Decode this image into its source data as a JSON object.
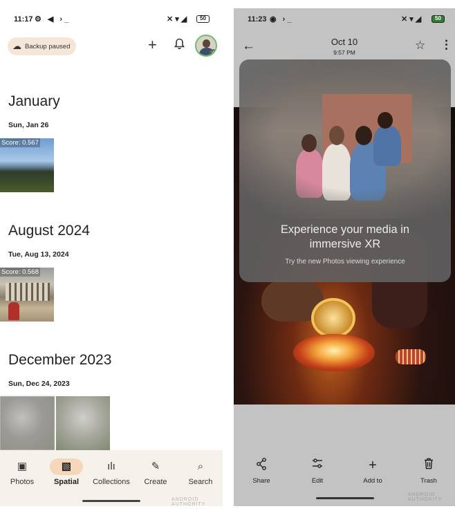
{
  "left": {
    "status": {
      "time": "11:17",
      "icons": "⚙ ◀ ›_",
      "right_icons": "🔕 ▾ ◢",
      "battery": "50"
    },
    "backup_chip": {
      "icon": "cloud-icon",
      "label": "Backup paused"
    },
    "header_icons": [
      "plus-icon",
      "bell-icon"
    ],
    "sections": [
      {
        "title": "January",
        "date": "Sun, Jan 26",
        "photos": [
          {
            "score": "Score: 0.567"
          }
        ]
      },
      {
        "title": "August 2024",
        "date": "Tue, Aug 13, 2024",
        "photos": [
          {
            "score": "Score: 0.568"
          }
        ]
      },
      {
        "title": "December 2023",
        "date": "Sun, Dec 24, 2023",
        "photos": [
          {},
          {}
        ]
      }
    ],
    "nav": [
      {
        "label": "Photos",
        "icon": "photo-icon",
        "active": false
      },
      {
        "label": "Spatial",
        "icon": "spatial-icon",
        "active": true
      },
      {
        "label": "Collections",
        "icon": "collections-icon",
        "active": false
      },
      {
        "label": "Create",
        "icon": "brush-icon",
        "active": false
      },
      {
        "label": "Search",
        "icon": "search-icon",
        "active": false
      }
    ]
  },
  "right": {
    "status": {
      "time": "11:23",
      "icons": "◉ ›_",
      "right_icons": "🔕 ▾ ◢",
      "battery": "50"
    },
    "header": {
      "date": "Oct 10",
      "time": "9:57 PM"
    },
    "xr_card": {
      "title_line1": "Experience your media in",
      "title_line2": "immersive XR",
      "subtitle": "Try the new Photos viewing experience"
    },
    "toolbar": [
      {
        "label": "Share",
        "icon": "share-icon"
      },
      {
        "label": "Edit",
        "icon": "edit-icon"
      },
      {
        "label": "Add to",
        "icon": "plus-icon"
      },
      {
        "label": "Trash",
        "icon": "trash-icon"
      }
    ]
  },
  "watermark": "ANDROID AUTHORITY",
  "colors": {
    "backup_chip": "#f6e6d8",
    "nav_active": "#f7d7b9",
    "nav_bg": "#f6f1ea",
    "right_bg": "#c3c3c3",
    "card_bg": "#626262"
  }
}
